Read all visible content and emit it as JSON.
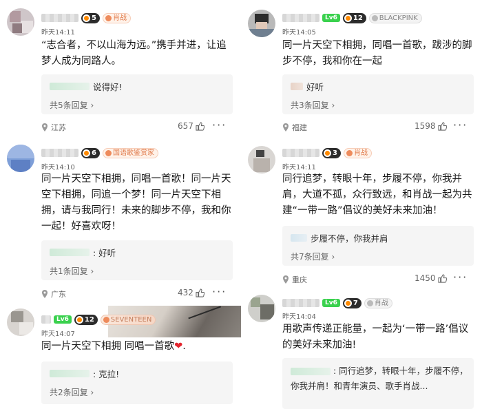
{
  "comments": [
    {
      "time": "昨天14:11",
      "level": "5",
      "tag": "肖战",
      "text": "“志合者，不以山海为远。”携手并进，让追梦人成为同路人。",
      "reply_text": "说得好!",
      "reply_count": "共5条回复",
      "location": "江苏",
      "likes": "657"
    },
    {
      "time": "昨天14:05",
      "level": "12",
      "lv6": "Lv6",
      "tag": "BLACKPINK",
      "text": "同一片天空下相拥，同唱一首歌，跋涉的脚步不停，我和你在一起",
      "reply_text": "好听",
      "reply_count": "共3条回复",
      "location": "福建",
      "likes": "1598"
    },
    {
      "time": "昨天14:10",
      "level": "6",
      "tag": "国语歌鉴赏家",
      "text": "同一片天空下相拥，同唱一首歌！同一片天空下相拥，同追一个梦！同一片天空下相拥，请与我同行！未来的脚步不停，我和你一起！好喜欢呀！",
      "reply_text": ": 好听",
      "reply_count": "共1条回复",
      "location": "广东",
      "likes": "432"
    },
    {
      "time": "昨天14:11",
      "level": "3",
      "tag": "肖战",
      "text": "同行追梦，转眼十年，步履不停，你我并肩，大道不孤，众行致远，和肖战一起为共建“一带一路”倡议的美好未来加油！",
      "reply_text": "步履不停，你我并肩",
      "reply_count": "共7条回复",
      "location": "重庆",
      "likes": "1450"
    },
    {
      "time": "昨天14:07",
      "level": "12",
      "lv6": "Lv6",
      "tag": "SEVENTEEN",
      "text": "同一片天空下相拥 同唱一首歌",
      "text_suffix": ".",
      "reply_text": ": 克拉!",
      "reply_count": "共2条回复"
    },
    {
      "time": "昨天14:04",
      "level": "7",
      "lv6": "Lv6",
      "tag": "肖战",
      "text": "用歌声传递正能量，一起为‘一带一路’倡议的美好未来加油!",
      "reply_text": ": 同行追梦，转眼十年，步履不停，你我并肩！和青年演员、歌手肖战..."
    }
  ],
  "icons": {
    "like": "thumb-up-icon",
    "more": "more-icon",
    "location": "location-pin-icon",
    "chevron": "chevron-right-icon"
  },
  "colors": {
    "tag_orange": "#e07a4a",
    "lv6_green": "#3ad14e",
    "heart_red": "#e3262f"
  }
}
